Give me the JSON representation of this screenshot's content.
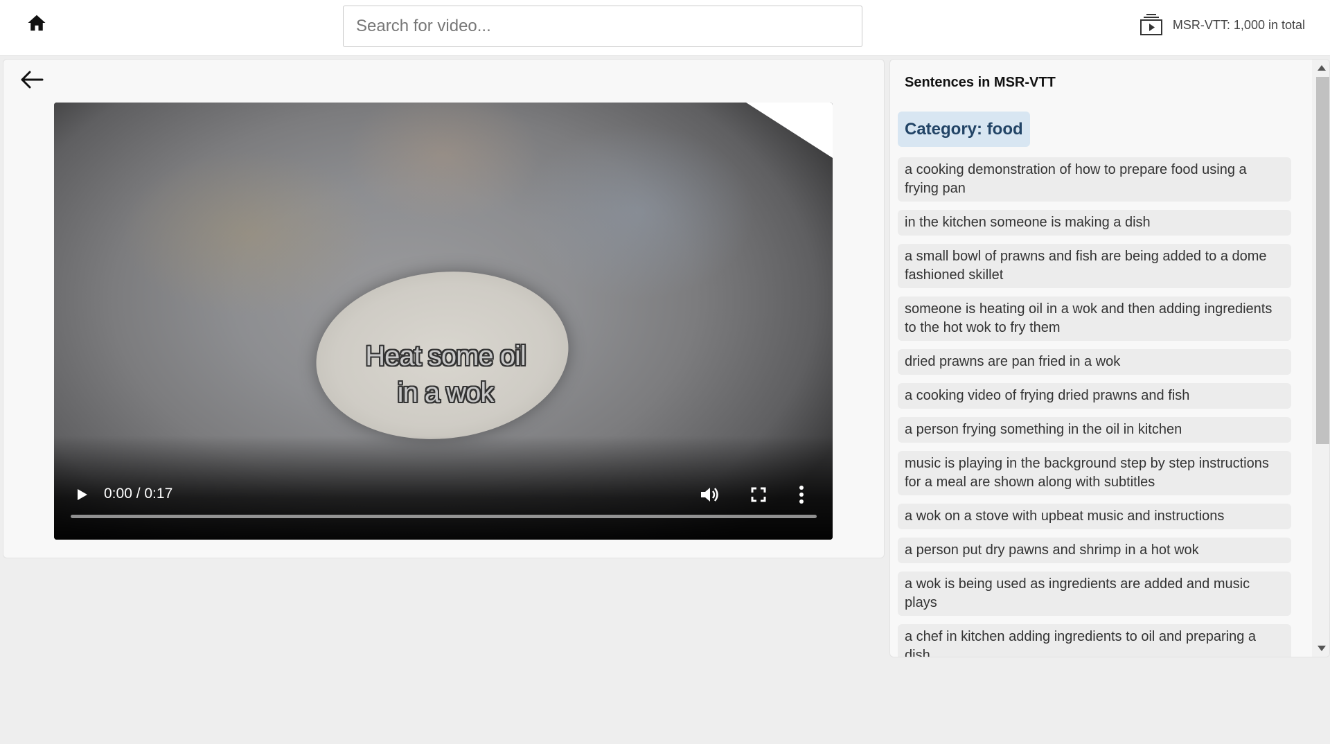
{
  "header": {
    "search": {
      "placeholder": "Search for video..."
    },
    "dataset": {
      "label": "MSR-VTT: 1,000 in total"
    },
    "icons": {
      "home": "home-icon",
      "dataset": "video-library-icon"
    }
  },
  "player": {
    "subtitle_line1": "Heat some oil",
    "subtitle_line2": "in a wok",
    "time": "0:00 / 0:17",
    "progress": 0,
    "icons": {
      "play": "play-icon",
      "volume": "volume-icon",
      "fullscreen": "fullscreen-icon",
      "more": "more-vertical-icon",
      "back": "arrow-left-icon"
    }
  },
  "sentences_panel": {
    "title": "Sentences in MSR-VTT",
    "category": "Category: food",
    "items": [
      "a cooking demonstration of how to prepare food using a frying pan",
      "in the kitchen someone is making a dish",
      "a small bowl of prawns and fish are being added to a dome fashioned skillet",
      "someone is heating oil in a wok and then adding ingredients to the hot wok to fry them",
      "dried prawns are pan fried in a wok",
      "a cooking video of frying dried prawns and fish",
      "a person frying something in the oil in kitchen",
      "music is playing in the background step by step instructions for a meal are shown along with subtitles",
      "a wok on a stove with upbeat music and instructions",
      "a person put dry pawns and shrimp in a hot wok",
      "a wok is being used as ingredients are added and music plays",
      "a chef in kitchen adding ingredients to oil and preparing a dish"
    ]
  }
}
